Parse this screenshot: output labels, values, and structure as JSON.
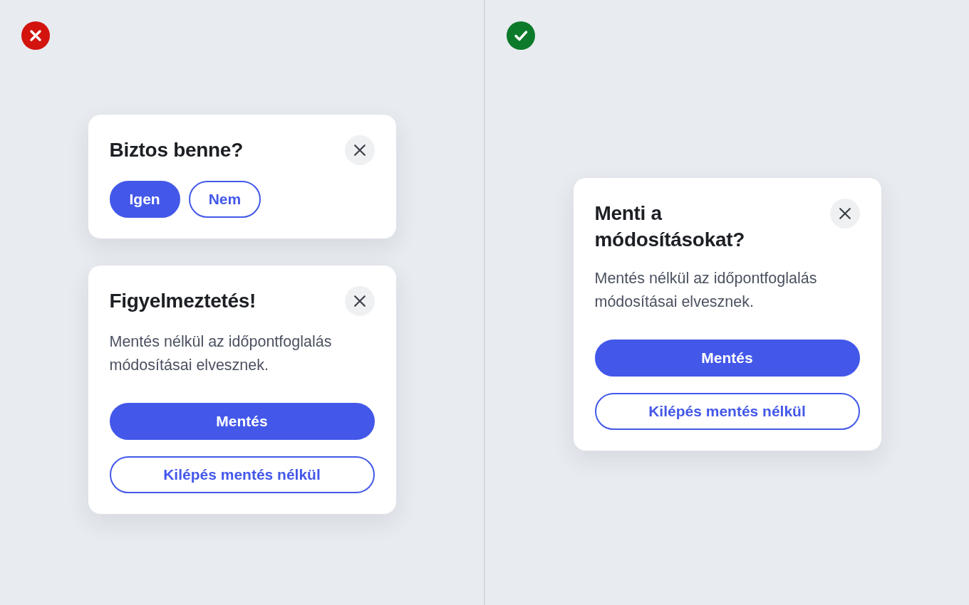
{
  "panels": [
    {
      "kind": "bad",
      "dialogs": [
        {
          "title": "Biztos benne?",
          "kind": "inline",
          "buttons": [
            {
              "label": "Igen",
              "kind": "primary"
            },
            {
              "label": "Nem",
              "kind": "outline"
            }
          ]
        },
        {
          "title": "Figyelmeztetés!",
          "message": "Mentés nélkül az időpontfoglalás módosításai elvesznek.",
          "kind": "stacked",
          "buttons": [
            {
              "label": "Mentés",
              "kind": "primary"
            },
            {
              "label": "Kilépés mentés nélkül",
              "kind": "outline"
            }
          ]
        }
      ]
    },
    {
      "kind": "good",
      "dialogs": [
        {
          "title": "Menti a módosításokat?",
          "message": "Mentés nélkül az időpontfoglalás módosításai elvesznek.",
          "kind": "stacked",
          "buttons": [
            {
              "label": "Mentés",
              "kind": "primary"
            },
            {
              "label": "Kilépés mentés nélkül",
              "kind": "outline"
            }
          ]
        }
      ]
    }
  ]
}
